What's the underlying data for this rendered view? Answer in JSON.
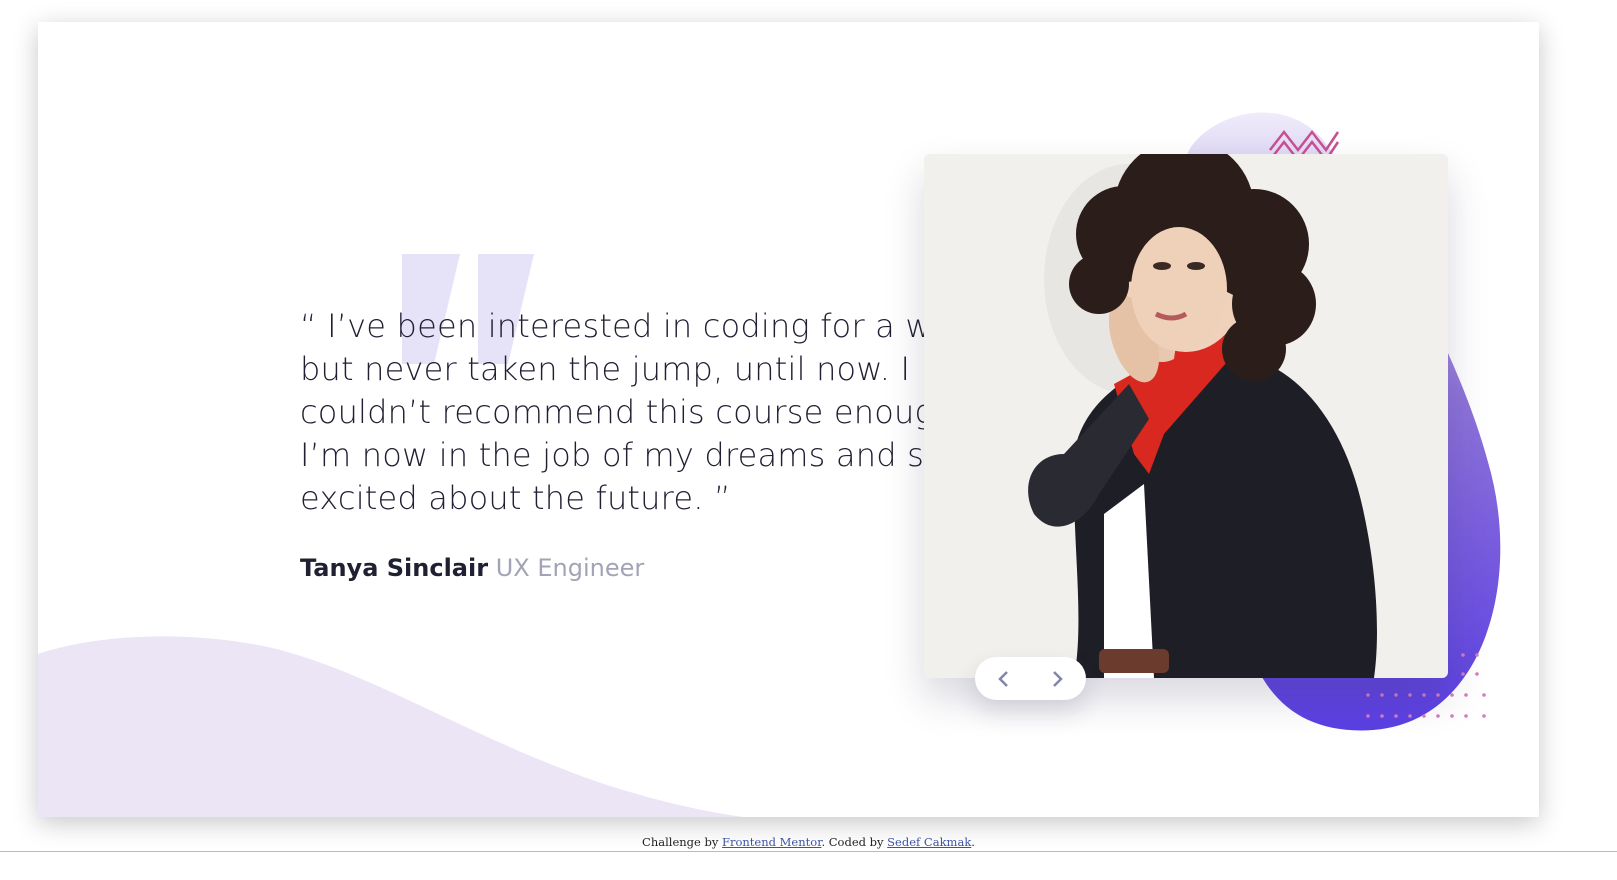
{
  "testimonial": {
    "quote": "“ I’ve been interested in coding for a while but never taken the jump, until now. I couldn’t recommend this course enough. I’m now in the job of my dreams and so excited about the future. ”",
    "author_name": "Tanya Sinclair",
    "author_role": "UX Engineer"
  },
  "navigation": {
    "prev_icon": "chevron-left-icon",
    "next_icon": "chevron-right-icon"
  },
  "footer": {
    "prefix": "Challenge by ",
    "link1": "Frontend Mentor",
    "middle": ". Coded by ",
    "link2": "Sedef Cakmak",
    "suffix": "."
  },
  "colors": {
    "text_dark": "#202033",
    "text_muted": "#a3a3b8",
    "curve": "#ebe5f6",
    "blob_top": "#8a6fd8",
    "blob_bottom": "#5840e6",
    "accent_pink": "#c94f94"
  }
}
